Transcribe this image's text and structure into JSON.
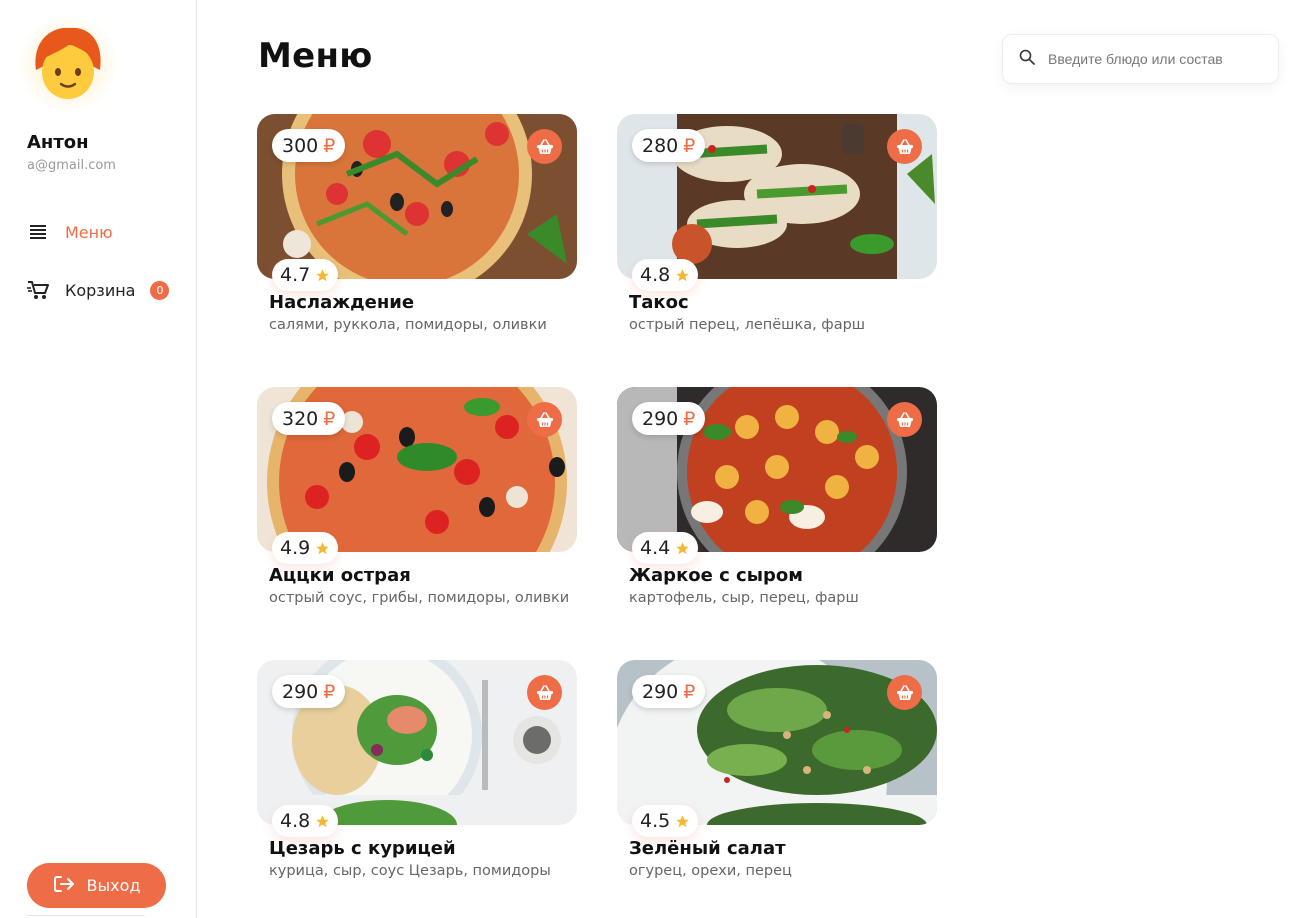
{
  "user": {
    "name": "Антон",
    "email": "a@gmail.com",
    "avatar_icon": "person-emoji-icon"
  },
  "nav": {
    "menu_label": "Меню",
    "cart_label": "Корзина",
    "cart_count": "0"
  },
  "logout_label": "Выход",
  "page_title": "Меню",
  "search": {
    "placeholder": "Введите блюдо или состав"
  },
  "currency": "₽",
  "accent_color": "#ef6d46",
  "star_color": "#f5b82e",
  "dishes": [
    {
      "price": "300",
      "rating": "4.7",
      "name": "Наслаждение",
      "ingredients": "салями, руккола, помидоры, оливки",
      "image_icon": "pizza-photo"
    },
    {
      "price": "280",
      "rating": "4.8",
      "name": "Такос",
      "ingredients": "острый перец, лепёшка, фарш",
      "image_icon": "tacos-photo"
    },
    {
      "price": "320",
      "rating": "4.9",
      "name": "Аццки острая",
      "ingredients": "острый соус, грибы, помидоры, оливки",
      "image_icon": "pizza-photo"
    },
    {
      "price": "290",
      "rating": "4.4",
      "name": "Жаркое с сыром",
      "ingredients": "картофель, сыр, перец, фарш",
      "image_icon": "stew-photo"
    },
    {
      "price": "290",
      "rating": "4.8",
      "name": "Цезарь с курицей",
      "ingredients": "курица, сыр, соус Цезарь, помидоры",
      "image_icon": "salad-photo"
    },
    {
      "price": "290",
      "rating": "4.5",
      "name": "Зелёный салат",
      "ingredients": "огурец, орехи, перец",
      "image_icon": "green-salad-photo"
    }
  ]
}
